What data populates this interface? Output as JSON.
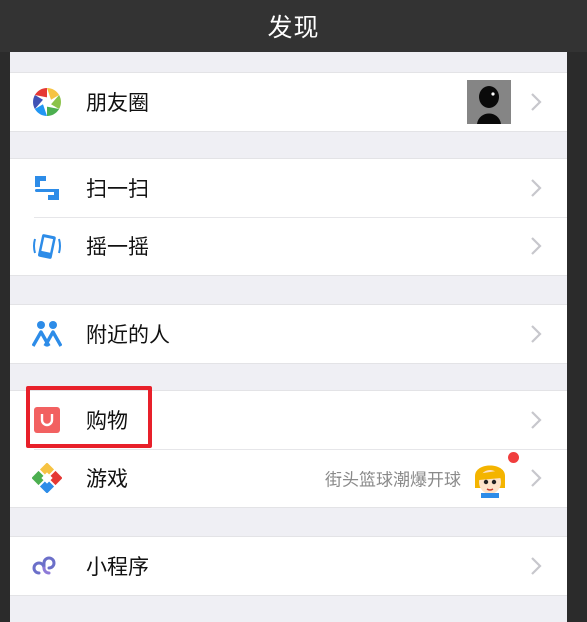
{
  "header": {
    "title": "发现"
  },
  "groups": [
    {
      "items": [
        {
          "label": "朋友圈",
          "icon": "moments-aperture-icon",
          "accessory": "thumbnail"
        }
      ]
    },
    {
      "items": [
        {
          "label": "扫一扫",
          "icon": "scan-icon"
        },
        {
          "label": "摇一摇",
          "icon": "shake-icon"
        }
      ]
    },
    {
      "items": [
        {
          "label": "附近的人",
          "icon": "people-nearby-icon"
        }
      ]
    },
    {
      "items": [
        {
          "label": "购物",
          "icon": "shopping-bag-icon",
          "highlighted": true
        },
        {
          "label": "游戏",
          "icon": "games-icon",
          "right_text": "街头篮球潮爆开球",
          "badge": "red-dot"
        }
      ]
    },
    {
      "items": [
        {
          "label": "小程序",
          "icon": "mini-program-icon"
        }
      ]
    }
  ],
  "colors": {
    "header_bg": "#333333",
    "page_bg": "#efeff4",
    "cell_bg": "#ffffff",
    "highlight": "#e8202a",
    "badge": "#f03d3d",
    "scan_icon": "#2d8ce8",
    "shake_icon": "#2d8ce8",
    "nearby_icon": "#2d8ce8",
    "shopping_icon": "#f26161",
    "mini_program_icon": "#6b6fc9"
  }
}
